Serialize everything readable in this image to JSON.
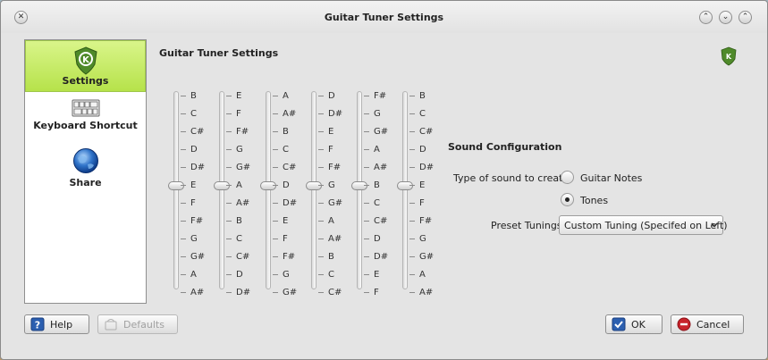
{
  "window": {
    "title": "Guitar Tuner Settings"
  },
  "sidebar": {
    "items": [
      {
        "label": "Settings",
        "icon": "kde-settings-icon",
        "selected": true
      },
      {
        "label": "Keyboard Shortcut",
        "icon": "keyboard-icon",
        "selected": false
      },
      {
        "label": "Share",
        "icon": "globe-icon",
        "selected": false
      }
    ]
  },
  "page": {
    "title": "Guitar Tuner Settings"
  },
  "strings": [
    {
      "notes": [
        "B",
        "C",
        "C#",
        "D",
        "D#",
        "E",
        "F",
        "F#",
        "G",
        "G#",
        "A",
        "A#"
      ],
      "selected": "E"
    },
    {
      "notes": [
        "E",
        "F",
        "F#",
        "G",
        "G#",
        "A",
        "A#",
        "B",
        "C",
        "C#",
        "D",
        "D#"
      ],
      "selected": "A"
    },
    {
      "notes": [
        "A",
        "A#",
        "B",
        "C",
        "C#",
        "D",
        "D#",
        "E",
        "F",
        "F#",
        "G",
        "G#"
      ],
      "selected": "D"
    },
    {
      "notes": [
        "D",
        "D#",
        "E",
        "F",
        "F#",
        "G",
        "G#",
        "A",
        "A#",
        "B",
        "C",
        "C#"
      ],
      "selected": "G"
    },
    {
      "notes": [
        "F#",
        "G",
        "G#",
        "A",
        "A#",
        "B",
        "C",
        "C#",
        "D",
        "D#",
        "E",
        "F"
      ],
      "selected": "B"
    },
    {
      "notes": [
        "B",
        "C",
        "C#",
        "D",
        "D#",
        "E",
        "F",
        "F#",
        "G",
        "G#",
        "A",
        "A#"
      ],
      "selected": "E"
    }
  ],
  "sound": {
    "header": "Sound Configuration",
    "type_label": "Type of sound to create",
    "options": [
      {
        "label": "Guitar Notes",
        "checked": false
      },
      {
        "label": "Tones",
        "checked": true
      }
    ],
    "preset_label": "Preset Tunings",
    "preset_value": "Custom Tuning (Specifed on Left)"
  },
  "buttons": {
    "help": "Help",
    "defaults": "Defaults",
    "ok": "OK",
    "cancel": "Cancel"
  },
  "colors": {
    "selected_bg": "#c5ec63",
    "kde_green": "#4f8a2a"
  }
}
